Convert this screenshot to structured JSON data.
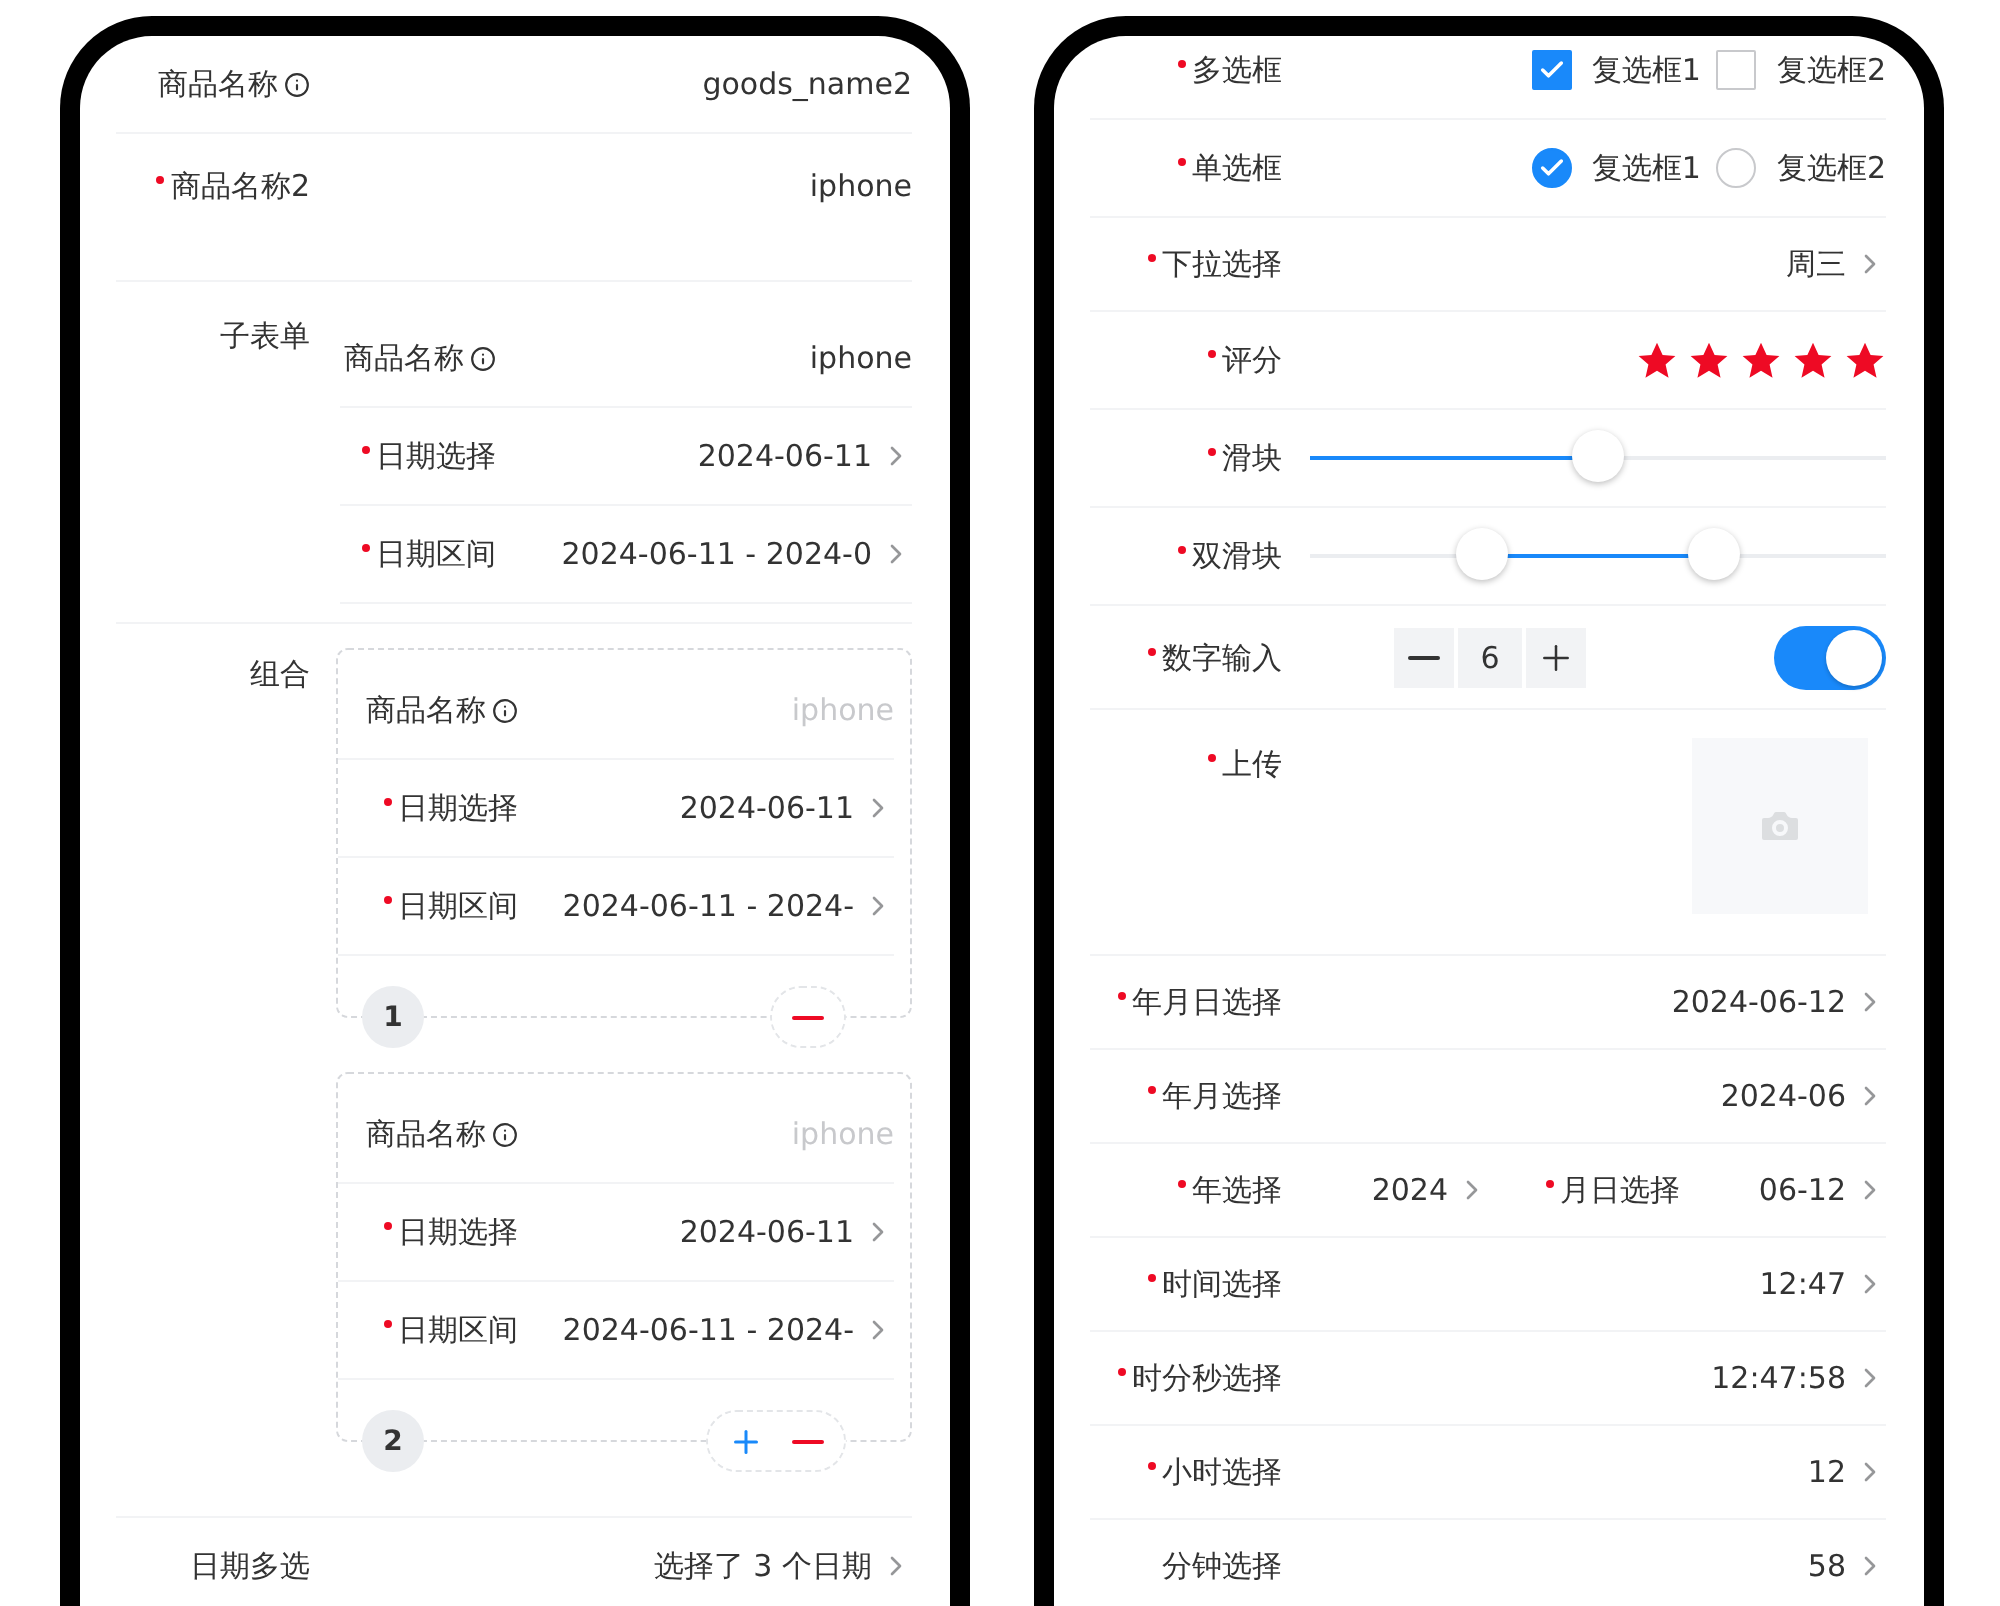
{
  "phones": [
    {
      "rows": [
        {
          "kind": "text",
          "label": "商品名称",
          "info": true,
          "value": "goods_name2"
        },
        {
          "kind": "textarea",
          "label": "商品名称2",
          "required": true,
          "value": "iphone"
        },
        {
          "kind": "subform",
          "label": "子表单",
          "rows": [
            {
              "kind": "text",
              "label": "商品名称",
              "info": true,
              "value": "iphone"
            },
            {
              "kind": "picker",
              "label": "日期选择",
              "required": true,
              "value": "2024-06-11"
            },
            {
              "kind": "picker",
              "label": "日期区间",
              "required": true,
              "value": "2024-06-11 - 2024-0"
            }
          ]
        },
        {
          "kind": "group",
          "label": "组合",
          "cards": [
            {
              "index": "1",
              "can_add": false,
              "rows": [
                {
                  "kind": "text",
                  "label": "商品名称",
                  "info": true,
                  "placeholder": "iphone"
                },
                {
                  "kind": "picker",
                  "label": "日期选择",
                  "required": true,
                  "value": "2024-06-11"
                },
                {
                  "kind": "picker",
                  "label": "日期区间",
                  "required": true,
                  "value": "2024-06-11 - 2024-"
                }
              ]
            },
            {
              "index": "2",
              "can_add": true,
              "rows": [
                {
                  "kind": "text",
                  "label": "商品名称",
                  "info": true,
                  "placeholder": "iphone"
                },
                {
                  "kind": "picker",
                  "label": "日期选择",
                  "required": true,
                  "value": "2024-06-11"
                },
                {
                  "kind": "picker",
                  "label": "日期区间",
                  "required": true,
                  "value": "2024-06-11 - 2024-"
                }
              ]
            }
          ]
        },
        {
          "kind": "picker",
          "label": "日期多选",
          "value": "选择了 3 个日期"
        }
      ]
    },
    {
      "rows": [
        {
          "kind": "checkbox",
          "label": "多选框",
          "required": true,
          "options": [
            {
              "label": "复选框1",
              "checked": true
            },
            {
              "label": "复选框2",
              "checked": false
            }
          ]
        },
        {
          "kind": "radio",
          "label": "单选框",
          "required": true,
          "options": [
            {
              "label": "复选框1",
              "selected": true
            },
            {
              "label": "复选框2",
              "selected": false
            }
          ]
        },
        {
          "kind": "picker",
          "label": "下拉选择",
          "required": true,
          "value": "周三"
        },
        {
          "kind": "rate",
          "label": "评分",
          "required": true,
          "stars": 5
        },
        {
          "kind": "slider",
          "label": "滑块",
          "required": true,
          "level": 0.5
        },
        {
          "kind": "range",
          "label": "双滑块",
          "required": true,
          "thumbs": [
            {
              "level": 0.3
            },
            {
              "level": 0.7
            }
          ]
        },
        {
          "kind": "stepper",
          "label": "数字输入",
          "required": true,
          "value": "6",
          "switch": {
            "on": true
          }
        },
        {
          "kind": "upload",
          "label": "上传",
          "required": true
        },
        {
          "kind": "picker",
          "label": "年月日选择",
          "required": true,
          "value": "2024-06-12"
        },
        {
          "kind": "picker",
          "label": "年月选择",
          "required": true,
          "value": "2024-06"
        },
        {
          "kind": "split",
          "parts": [
            {
              "label": "年选择",
              "required": true,
              "value": "2024"
            },
            {
              "label": "月日选择",
              "required": true,
              "value": "06-12"
            }
          ]
        },
        {
          "kind": "picker",
          "label": "时间选择",
          "required": true,
          "value": "12:47"
        },
        {
          "kind": "picker",
          "label": "时分秒选择",
          "required": true,
          "value": "12:47:58"
        },
        {
          "kind": "picker",
          "label": "小时选择",
          "required": true,
          "value": "12"
        },
        {
          "kind": "picker",
          "label": "分钟选择",
          "value": "58"
        }
      ]
    }
  ]
}
